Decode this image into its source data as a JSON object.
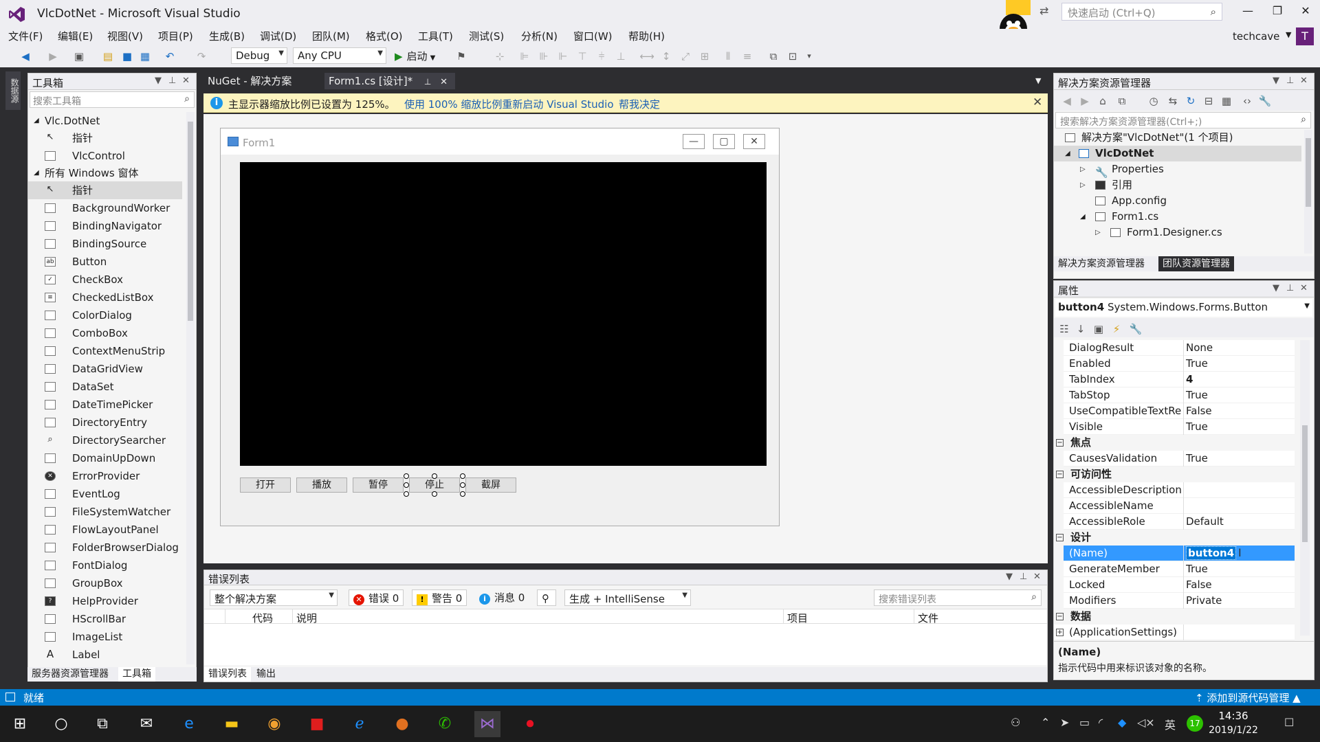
{
  "window": {
    "title": "VlcDotNet - Microsoft Visual Studio",
    "quick_launch_placeholder": "快速启动 (Ctrl+Q)",
    "user": "techcave",
    "avatar_letter": "T",
    "qq_lang": "英"
  },
  "menu": [
    "文件(F)",
    "编辑(E)",
    "视图(V)",
    "项目(P)",
    "生成(B)",
    "调试(D)",
    "团队(M)",
    "格式(O)",
    "工具(T)",
    "测试(S)",
    "分析(N)",
    "窗口(W)",
    "帮助(H)"
  ],
  "toolbar": {
    "config": "Debug",
    "platform": "Any CPU",
    "start_label": "启动"
  },
  "left_strip": {
    "vertical_tab": "数据源"
  },
  "toolbox": {
    "title": "工具箱",
    "search_placeholder": "搜索工具箱",
    "group1": "Vlc.DotNet",
    "group1_items": [
      "指针",
      "VlcControl"
    ],
    "group2": "所有 Windows 窗体",
    "group2_items": [
      "指针",
      "BackgroundWorker",
      "BindingNavigator",
      "BindingSource",
      "Button",
      "CheckBox",
      "CheckedListBox",
      "ColorDialog",
      "ComboBox",
      "ContextMenuStrip",
      "DataGridView",
      "DataSet",
      "DateTimePicker",
      "DirectoryEntry",
      "DirectorySearcher",
      "DomainUpDown",
      "ErrorProvider",
      "EventLog",
      "FileSystemWatcher",
      "FlowLayoutPanel",
      "FolderBrowserDialog",
      "FontDialog",
      "GroupBox",
      "HelpProvider",
      "HScrollBar",
      "ImageList",
      "Label"
    ],
    "bottom_tabs": [
      "服务器资源管理器",
      "工具箱"
    ]
  },
  "doc_tabs": [
    "NuGet - 解决方案",
    "Form1.cs [设计]*"
  ],
  "infobar": {
    "message": "主显示器缩放比例已设置为 125%。",
    "link1": "使用 100% 缩放比例重新启动 Visual Studio",
    "link2": "帮我决定"
  },
  "form": {
    "title": "Form1",
    "buttons": [
      "打开",
      "播放",
      "暂停",
      "停止",
      "截屏"
    ]
  },
  "error_list": {
    "title": "错误列表",
    "scope": "整个解决方案",
    "errors": "错误 0",
    "warnings": "警告 0",
    "messages": "消息 0",
    "source": "生成 + IntelliSense",
    "search_placeholder": "搜索错误列表",
    "columns": [
      "代码",
      "说明",
      "项目",
      "文件"
    ],
    "bottom_tabs": [
      "错误列表",
      "输出"
    ]
  },
  "solution_explorer": {
    "title": "解决方案资源管理器",
    "search_placeholder": "搜索解决方案资源管理器(Ctrl+;)",
    "items": [
      "解决方案\"VlcDotNet\"(1 个项目)",
      "VlcDotNet",
      "Properties",
      "引用",
      "App.config",
      "Form1.cs",
      "Form1.Designer.cs"
    ],
    "tabs": [
      "解决方案资源管理器",
      "团队资源管理器"
    ]
  },
  "properties": {
    "title": "属性",
    "object_name": "button4",
    "object_type": "System.Windows.Forms.Button",
    "rows_top": [
      {
        "name": "DialogResult",
        "value": "None"
      },
      {
        "name": "Enabled",
        "value": "True"
      },
      {
        "name": "TabIndex",
        "value": "4"
      },
      {
        "name": "TabStop",
        "value": "True"
      },
      {
        "name": "UseCompatibleTextRendering",
        "value": "False"
      },
      {
        "name": "Visible",
        "value": "True"
      }
    ],
    "cat_focus": "焦点",
    "focus_rows": [
      {
        "name": "CausesValidation",
        "value": "True"
      }
    ],
    "cat_access": "可访问性",
    "access_rows": [
      {
        "name": "AccessibleDescription",
        "value": ""
      },
      {
        "name": "AccessibleName",
        "value": ""
      },
      {
        "name": "AccessibleRole",
        "value": "Default"
      }
    ],
    "cat_design": "设计",
    "design_rows": [
      {
        "name": "(Name)",
        "value": "button4"
      },
      {
        "name": "GenerateMember",
        "value": "True"
      },
      {
        "name": "Locked",
        "value": "False"
      },
      {
        "name": "Modifiers",
        "value": "Private"
      }
    ],
    "cat_data": "数据",
    "data_rows": [
      {
        "name": "(ApplicationSettings)",
        "value": ""
      }
    ],
    "desc_title": "(Name)",
    "desc_text": "指示代码中用来标识该对象的名称。"
  },
  "status": {
    "left": "就绪",
    "right": "添加到源代码管理"
  },
  "taskbar": {
    "time": "14:36",
    "date": "2019/1/22",
    "badge": "17",
    "ime": "英"
  }
}
